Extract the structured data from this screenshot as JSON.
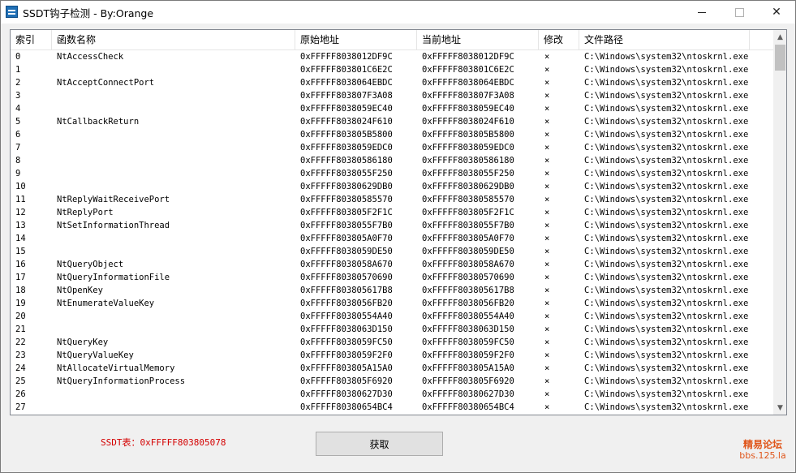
{
  "window": {
    "title": "SSDT钩子检测 - By:Orange",
    "minimize_glyph": "",
    "close_glyph": "✕"
  },
  "table": {
    "columns": [
      "索引",
      "函数名称",
      "原始地址",
      "当前地址",
      "修改",
      "文件路径"
    ],
    "rows": [
      [
        "0",
        "NtAccessCheck",
        "0xFFFFF8038012DF9C",
        "0xFFFFF8038012DF9C",
        "×",
        "C:\\Windows\\system32\\ntoskrnl.exe"
      ],
      [
        "1",
        "",
        "0xFFFFF803801C6E2C",
        "0xFFFFF803801C6E2C",
        "×",
        "C:\\Windows\\system32\\ntoskrnl.exe"
      ],
      [
        "2",
        "NtAcceptConnectPort",
        "0xFFFFF8038064EBDC",
        "0xFFFFF8038064EBDC",
        "×",
        "C:\\Windows\\system32\\ntoskrnl.exe"
      ],
      [
        "3",
        "",
        "0xFFFFF803807F3A08",
        "0xFFFFF803807F3A08",
        "×",
        "C:\\Windows\\system32\\ntoskrnl.exe"
      ],
      [
        "4",
        "",
        "0xFFFFF8038059EC40",
        "0xFFFFF8038059EC40",
        "×",
        "C:\\Windows\\system32\\ntoskrnl.exe"
      ],
      [
        "5",
        "NtCallbackReturn",
        "0xFFFFF8038024F610",
        "0xFFFFF8038024F610",
        "×",
        "C:\\Windows\\system32\\ntoskrnl.exe"
      ],
      [
        "6",
        "",
        "0xFFFFF803805B5800",
        "0xFFFFF803805B5800",
        "×",
        "C:\\Windows\\system32\\ntoskrnl.exe"
      ],
      [
        "7",
        "",
        "0xFFFFF8038059EDC0",
        "0xFFFFF8038059EDC0",
        "×",
        "C:\\Windows\\system32\\ntoskrnl.exe"
      ],
      [
        "8",
        "",
        "0xFFFFF80380586180",
        "0xFFFFF80380586180",
        "×",
        "C:\\Windows\\system32\\ntoskrnl.exe"
      ],
      [
        "9",
        "",
        "0xFFFFF8038055F250",
        "0xFFFFF8038055F250",
        "×",
        "C:\\Windows\\system32\\ntoskrnl.exe"
      ],
      [
        "10",
        "",
        "0xFFFFF80380629DB0",
        "0xFFFFF80380629DB0",
        "×",
        "C:\\Windows\\system32\\ntoskrnl.exe"
      ],
      [
        "11",
        "NtReplyWaitReceivePort",
        "0xFFFFF80380585570",
        "0xFFFFF80380585570",
        "×",
        "C:\\Windows\\system32\\ntoskrnl.exe"
      ],
      [
        "12",
        "NtReplyPort",
        "0xFFFFF803805F2F1C",
        "0xFFFFF803805F2F1C",
        "×",
        "C:\\Windows\\system32\\ntoskrnl.exe"
      ],
      [
        "13",
        "NtSetInformationThread",
        "0xFFFFF8038055F7B0",
        "0xFFFFF8038055F7B0",
        "×",
        "C:\\Windows\\system32\\ntoskrnl.exe"
      ],
      [
        "14",
        "",
        "0xFFFFF803805A0F70",
        "0xFFFFF803805A0F70",
        "×",
        "C:\\Windows\\system32\\ntoskrnl.exe"
      ],
      [
        "15",
        "",
        "0xFFFFF8038059DE50",
        "0xFFFFF8038059DE50",
        "×",
        "C:\\Windows\\system32\\ntoskrnl.exe"
      ],
      [
        "16",
        "NtQueryObject",
        "0xFFFFF8038058A670",
        "0xFFFFF8038058A670",
        "×",
        "C:\\Windows\\system32\\ntoskrnl.exe"
      ],
      [
        "17",
        "NtQueryInformationFile",
        "0xFFFFF80380570690",
        "0xFFFFF80380570690",
        "×",
        "C:\\Windows\\system32\\ntoskrnl.exe"
      ],
      [
        "18",
        "NtOpenKey",
        "0xFFFFF803805617B8",
        "0xFFFFF803805617B8",
        "×",
        "C:\\Windows\\system32\\ntoskrnl.exe"
      ],
      [
        "19",
        "NtEnumerateValueKey",
        "0xFFFFF8038056FB20",
        "0xFFFFF8038056FB20",
        "×",
        "C:\\Windows\\system32\\ntoskrnl.exe"
      ],
      [
        "20",
        "",
        "0xFFFFF80380554A40",
        "0xFFFFF80380554A40",
        "×",
        "C:\\Windows\\system32\\ntoskrnl.exe"
      ],
      [
        "21",
        "",
        "0xFFFFF8038063D150",
        "0xFFFFF8038063D150",
        "×",
        "C:\\Windows\\system32\\ntoskrnl.exe"
      ],
      [
        "22",
        "NtQueryKey",
        "0xFFFFF8038059FC50",
        "0xFFFFF8038059FC50",
        "×",
        "C:\\Windows\\system32\\ntoskrnl.exe"
      ],
      [
        "23",
        "NtQueryValueKey",
        "0xFFFFF8038059F2F0",
        "0xFFFFF8038059F2F0",
        "×",
        "C:\\Windows\\system32\\ntoskrnl.exe"
      ],
      [
        "24",
        "NtAllocateVirtualMemory",
        "0xFFFFF803805A15A0",
        "0xFFFFF803805A15A0",
        "×",
        "C:\\Windows\\system32\\ntoskrnl.exe"
      ],
      [
        "25",
        "NtQueryInformationProcess",
        "0xFFFFF803805F6920",
        "0xFFFFF803805F6920",
        "×",
        "C:\\Windows\\system32\\ntoskrnl.exe"
      ],
      [
        "26",
        "",
        "0xFFFFF80380627D30",
        "0xFFFFF80380627D30",
        "×",
        "C:\\Windows\\system32\\ntoskrnl.exe"
      ],
      [
        "27",
        "",
        "0xFFFFF80380654BC4",
        "0xFFFFF80380654BC4",
        "×",
        "C:\\Windows\\system32\\ntoskrnl.exe"
      ]
    ]
  },
  "footer": {
    "ssdt_label": "SSDT表：0xFFFFF803805078",
    "fetch_button": "获取",
    "watermark_line1": "精易论坛",
    "watermark_line2": "bbs.125.la"
  },
  "colors": {
    "ssdt_label": "#d40000",
    "watermark": "#e0561b"
  }
}
